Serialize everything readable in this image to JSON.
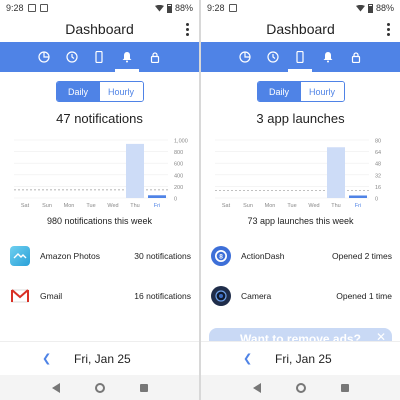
{
  "left": {
    "status": {
      "time": "9:28",
      "battery": "88%"
    },
    "title": "Dashboard",
    "tabs": [
      {
        "icon": "pie-chart-icon"
      },
      {
        "icon": "clock-icon"
      },
      {
        "icon": "phone-icon"
      },
      {
        "icon": "bell-icon",
        "active": true
      },
      {
        "icon": "lock-icon"
      }
    ],
    "toggle": {
      "daily": "Daily",
      "hourly": "Hourly",
      "selected": "daily"
    },
    "headline": "47 notifications",
    "summary": "980 notifications this week",
    "chart_data": {
      "type": "bar",
      "categories": [
        "Sat",
        "Sun",
        "Mon",
        "Tue",
        "Wed",
        "Thu",
        "Fri"
      ],
      "values": [
        0,
        0,
        0,
        0,
        0,
        933,
        47
      ],
      "ylim": [
        0,
        1000
      ],
      "yticks": [
        "1,000",
        "800",
        "600",
        "400",
        "200",
        "0"
      ],
      "highlight": "Fri",
      "average_line": true
    },
    "rows": [
      {
        "name": "Amazon Photos",
        "value": "30 notifications",
        "icon": "amazon-photos-icon"
      },
      {
        "name": "Gmail",
        "value": "16 notifications",
        "icon": "gmail-icon"
      }
    ],
    "date": "Fri, Jan 25"
  },
  "right": {
    "status": {
      "time": "9:28",
      "battery": "88%"
    },
    "title": "Dashboard",
    "tabs": [
      {
        "icon": "pie-chart-icon"
      },
      {
        "icon": "clock-icon"
      },
      {
        "icon": "phone-icon",
        "active": true
      },
      {
        "icon": "bell-icon"
      },
      {
        "icon": "lock-icon"
      }
    ],
    "toggle": {
      "daily": "Daily",
      "hourly": "Hourly",
      "selected": "daily"
    },
    "headline": "3 app launches",
    "summary": "73 app launches this week",
    "chart_data": {
      "type": "bar",
      "categories": [
        "Sat",
        "Sun",
        "Mon",
        "Tue",
        "Wed",
        "Thu",
        "Fri"
      ],
      "values": [
        0,
        0,
        0,
        0,
        0,
        70,
        3
      ],
      "ylim": [
        0,
        80
      ],
      "yticks": [
        "80",
        "64",
        "48",
        "32",
        "16",
        "0"
      ],
      "highlight": "Fri",
      "average_line": true
    },
    "rows": [
      {
        "name": "ActionDash",
        "value": "Opened 2 times",
        "icon": "actiondash-icon"
      },
      {
        "name": "Camera",
        "value": "Opened 1 time",
        "icon": "camera-icon"
      }
    ],
    "ad": "Want to remove ads?",
    "date": "Fri, Jan 25"
  }
}
